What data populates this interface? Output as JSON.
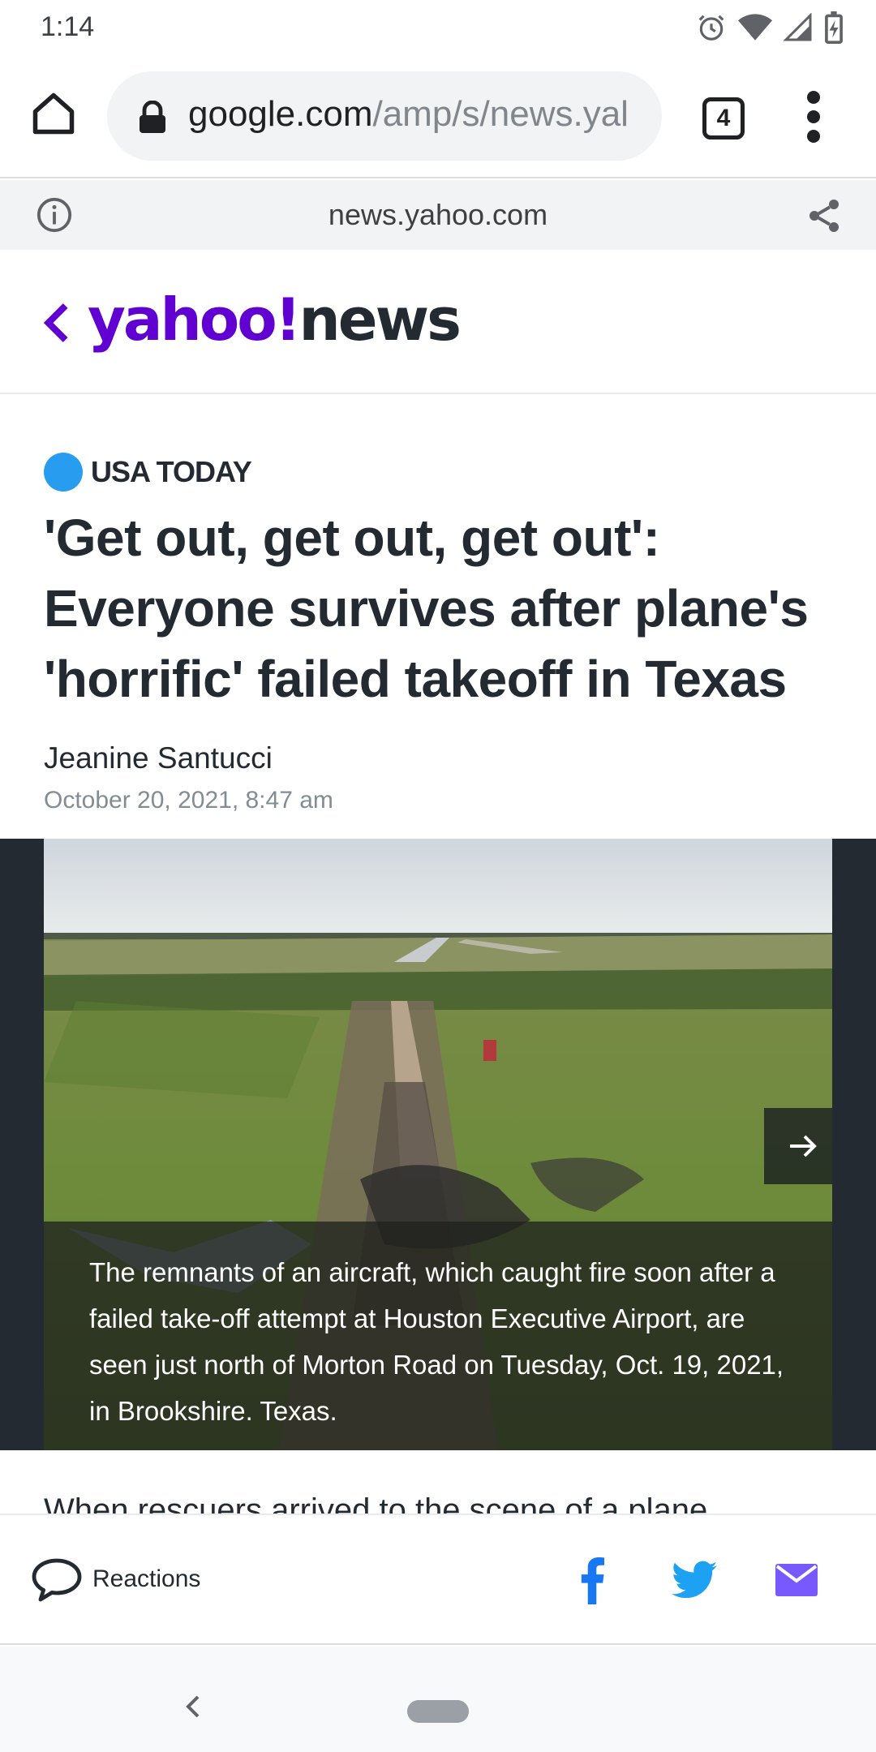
{
  "status_bar": {
    "time": "1:14",
    "icons": [
      "alarm-icon",
      "wifi-icon",
      "signal-icon",
      "battery-charging-icon"
    ]
  },
  "browser": {
    "url_host": "google.com",
    "url_path": "/amp/s/news.yal",
    "tab_count": "4",
    "amp_domain": "news.yahoo.com"
  },
  "site_header": {
    "logo_primary": "yahoo!",
    "logo_secondary": "news",
    "brand_color": "#6001d2"
  },
  "article": {
    "publisher": "USA TODAY",
    "headline": "'Get out, get out, get out': Everyone survives after plane's 'horrific' failed takeoff in Texas",
    "author": "Jeanine Santucci",
    "date": "October 20, 2021, 8:47 am",
    "photo_caption": "The remnants of an aircraft, which caught fire soon after a failed take-off attempt at Houston Executive Airport, are seen just north of Morton Road on Tuesday, Oct. 19, 2021, in Brookshire. Texas.",
    "body_start": "When rescuers arrived to the scene of a plane"
  },
  "bottom_bar": {
    "reactions_label": "Reactions",
    "share_icons": [
      "facebook-icon",
      "twitter-icon",
      "mail-icon"
    ],
    "facebook_color": "#1877f2",
    "twitter_color": "#1da1f2",
    "mail_color": "#7759ff"
  }
}
